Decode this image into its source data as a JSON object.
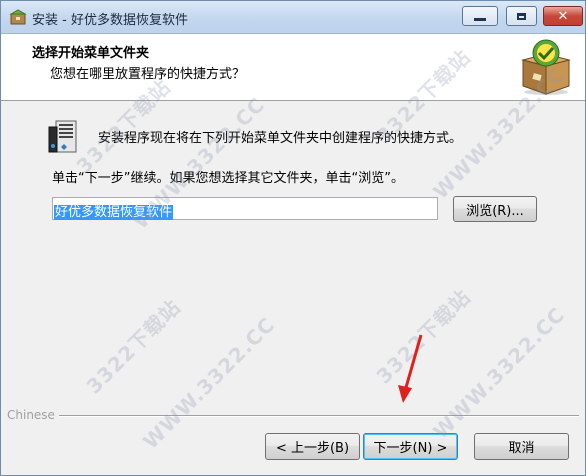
{
  "window": {
    "title": "安装 - 好优多数据恢复软件",
    "controls": {
      "minimize": "minimize",
      "maximize": "maximize",
      "close": "✕"
    }
  },
  "header": {
    "title": "选择开始菜单文件夹",
    "subtitle": "您想在哪里放置程序的快捷方式？"
  },
  "content": {
    "description": "安装程序现在将在下列开始菜单文件夹中创建程序的快捷方式。",
    "instruction": "单击“下一步”继续。如果您想选择其它文件夹，单击“浏览”。",
    "folder_value": "好优多数据恢复软件",
    "browse_label": "浏览(R)..."
  },
  "footer": {
    "language": "Chinese",
    "back_label": "< 上一步(B)",
    "next_label": "下一步(N) >",
    "cancel_label": "取消"
  },
  "watermark": {
    "text": "3322下载站",
    "url_text": "WWW.3322.CC"
  },
  "colors": {
    "selection": "#3399ff",
    "arrow": "#e0201c",
    "titlebar": "#c2d6ee"
  }
}
